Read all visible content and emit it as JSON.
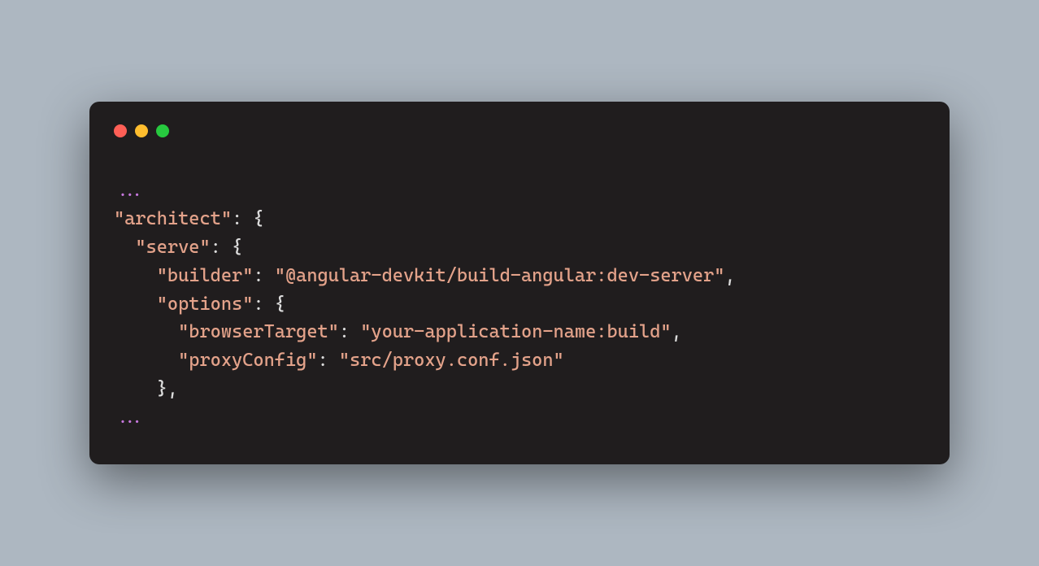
{
  "code": {
    "ellipsis_top": "...",
    "k_architect": "\"architect\"",
    "colon_sp": ": ",
    "brace_open": "{",
    "k_serve": "\"serve\"",
    "k_builder": "\"builder\"",
    "v_builder": "\"@angular-devkit/build-angular:dev-server\"",
    "comma": ",",
    "k_options": "\"options\"",
    "k_browserTarget": "\"browserTarget\"",
    "v_browserTarget": "\"your-application-name:build\"",
    "k_proxyConfig": "\"proxyConfig\"",
    "v_proxyConfig": "\"src/proxy.conf.json\"",
    "brace_close": "}",
    "brace_close_comma": "},",
    "ellipsis_bottom": "...",
    "indent1": "  ",
    "indent2": "    ",
    "indent3": "      "
  }
}
